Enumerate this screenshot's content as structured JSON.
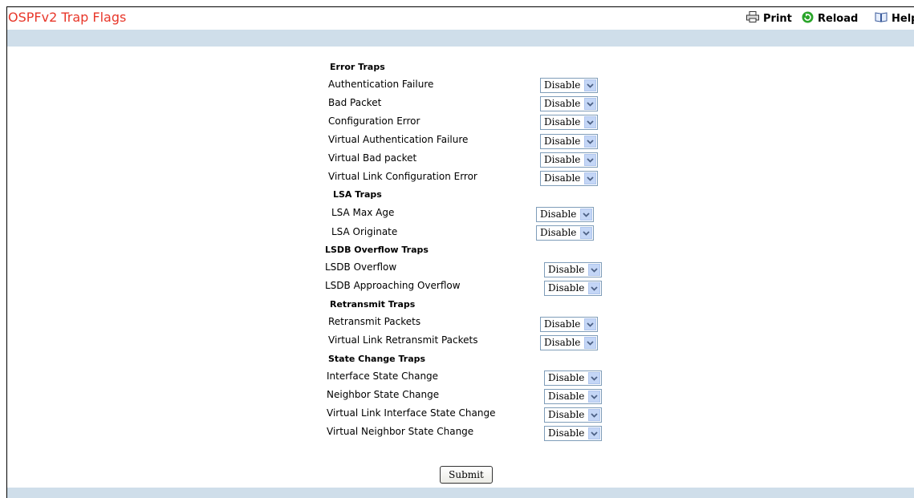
{
  "page": {
    "title": "OSPFv2 Trap Flags"
  },
  "toolbar": {
    "print": "Print",
    "reload": "Reload",
    "help": "Help"
  },
  "sections": {
    "error": {
      "header": "Error Traps",
      "items": [
        {
          "label": "Authentication Failure",
          "value": "Disable"
        },
        {
          "label": "Bad Packet",
          "value": "Disable"
        },
        {
          "label": "Configuration Error",
          "value": "Disable"
        },
        {
          "label": "Virtual Authentication Failure",
          "value": "Disable"
        },
        {
          "label": "Virtual Bad packet",
          "value": "Disable"
        },
        {
          "label": "Virtual Link Configuration Error",
          "value": "Disable"
        }
      ]
    },
    "lsa": {
      "header": "LSA Traps",
      "items": [
        {
          "label": "LSA Max Age",
          "value": "Disable"
        },
        {
          "label": "LSA Originate",
          "value": "Disable"
        }
      ]
    },
    "lsdb": {
      "header": "LSDB Overflow Traps",
      "items": [
        {
          "label": "LSDB Overflow",
          "value": "Disable"
        },
        {
          "label": "LSDB Approaching Overflow",
          "value": "Disable"
        }
      ]
    },
    "retransmit": {
      "header": "Retransmit Traps",
      "items": [
        {
          "label": "Retransmit Packets",
          "value": "Disable"
        },
        {
          "label": "Virtual Link Retransmit Packets",
          "value": "Disable"
        }
      ]
    },
    "state": {
      "header": "State Change Traps",
      "items": [
        {
          "label": "Interface State Change",
          "value": "Disable"
        },
        {
          "label": "Neighbor State Change",
          "value": "Disable"
        },
        {
          "label": "Virtual Link Interface State Change",
          "value": "Disable"
        },
        {
          "label": "Virtual Neighbor State Change",
          "value": "Disable"
        }
      ]
    }
  },
  "submit": {
    "label": "Submit"
  },
  "colors": {
    "title": "#e8372a",
    "band": "#cfdeea",
    "reload_icon": "#2aa52a"
  }
}
